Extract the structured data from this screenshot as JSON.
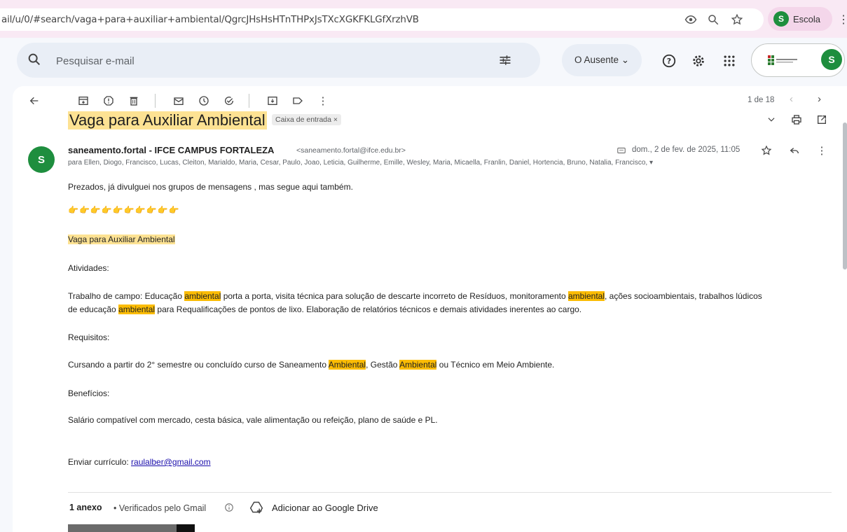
{
  "browser": {
    "url": "ail/u/0/#search/vaga+para+auxiliar+ambiental/QgrcJHsHsHTnTHPxJsTXcXGKFKLGfXrzhVB",
    "profile_initial": "S",
    "profile_label": "Escola"
  },
  "header": {
    "search_placeholder": "Pesquisar e-mail",
    "status_label": "O Ausente ⌄",
    "account_initial": "S"
  },
  "toolbar": {
    "pager": "1 de 18"
  },
  "email": {
    "subject": "Vaga para Auxiliar Ambiental",
    "label_chip": "Caixa de entrada ×",
    "sender_initial": "S",
    "sender_name": "saneamento.fortal - IFCE CAMPUS FORTALEZA",
    "sender_email": "<saneamento.fortal@ifce.edu.br>",
    "date": "dom., 2 de fev. de 2025, 11:05",
    "recipients": "para Ellen, Diogo, Francisco, Lucas, Cleiton, Marialdo, Maria, Cesar, Paulo, Joao, Leticia, Guilherme, Emille, Wesley, Maria, Micaella, Franlin, Daniel, Hortencia, Bruno, Natalia, Francisco, ▾",
    "intro": "Prezados, já divulguei nos grupos de mensagens , mas segue aqui também.",
    "pointers": "👉👉👉👉👉👉👉👉👉👉",
    "title": "Vaga para Auxiliar Ambiental",
    "atividades_label": "Atividades:",
    "trabalho_1": "Trabalho de campo: Educação ",
    "hl_1": "ambiental",
    "trabalho_2": " porta a porta, visita técnica para solução de descarte incorreto de Resíduos, monitoramento ",
    "hl_2": "ambiental",
    "trabalho_3": ", ações socioambientais, trabalhos lúdicos",
    "trabalho_4": " de educação ",
    "hl_3": "ambiental",
    "trabalho_5": " para Requalificações de pontos de lixo. Elaboração de relatórios técnicos e demais atividades inerentes ao cargo.",
    "requisitos_label": "Requisitos:",
    "req_1": "Cursando a partir do 2° semestre ou concluído curso de Saneamento ",
    "hl_4": "Ambiental",
    "req_2": ", Gestão ",
    "hl_5": "Ambiental",
    "req_3": " ou Técnico em Meio Ambiente.",
    "beneficios_label": "Benefícios:",
    "beneficios": "Salário compatível com mercado, cesta básica, vale alimentação ou refeição, plano de saúde e PL.",
    "enviar_label": "Enviar currículo: ",
    "enviar_email": "raulalber@gmail.com"
  },
  "attachments": {
    "count": "1 anexo",
    "verified": "•  Verificados pelo Gmail",
    "drive_label": "Adicionar ao Google Drive"
  }
}
